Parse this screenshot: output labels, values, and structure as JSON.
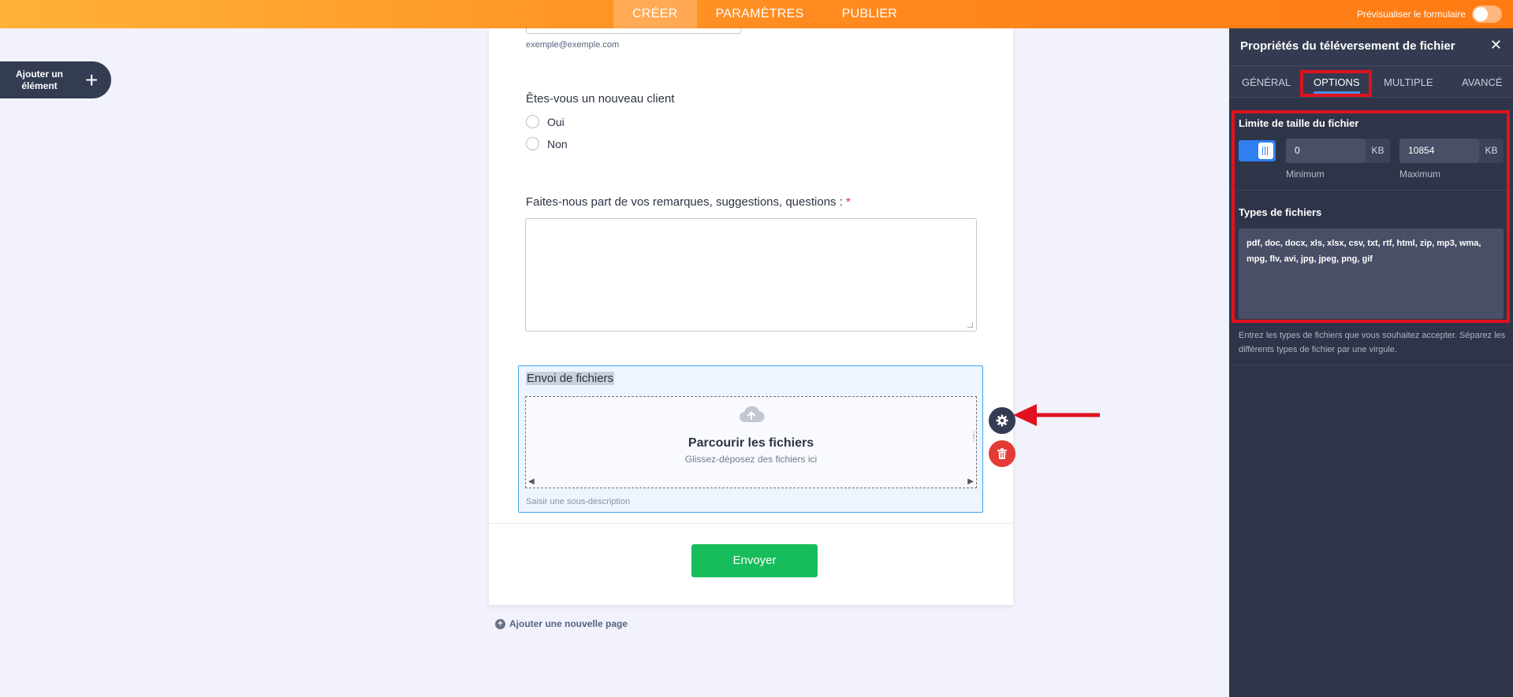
{
  "topbar": {
    "tabs": [
      "CRÉER",
      "PARAMÈTRES",
      "PUBLIER"
    ],
    "preview_label": "Prévisualiser le formulaire"
  },
  "sidebar": {
    "add_element_label": "Ajouter un élément"
  },
  "form": {
    "email_hint": "exemple@exemple.com",
    "question_new_client": "Êtes-vous un nouveau client",
    "radio_options": [
      "Oui",
      "Non"
    ],
    "question_feedback": "Faites-nous part de vos remarques, suggestions, questions :",
    "required_mark": "*",
    "upload_title": "Envoi de fichiers",
    "upload_browse": "Parcourir les fichiers",
    "upload_drag": "Glissez-déposez des fichiers ici",
    "upload_subdesc_placeholder": "Saisir une sous-description",
    "submit_label": "Envoyer",
    "add_page_label": "Ajouter une nouvelle page"
  },
  "panel": {
    "title": "Propriétés du téléversement de fichier",
    "close_glyph": "✕",
    "tabs": [
      "GÉNÉRAL",
      "OPTIONS",
      "MULTIPLE",
      "AVANCÉ"
    ],
    "active_tab": "OPTIONS",
    "size_limit_label": "Limite de taille du fichier",
    "size_limit_enabled": true,
    "min_value": "0",
    "max_value": "10854",
    "unit": "KB",
    "min_label": "Minimum",
    "max_label": "Maximum",
    "file_types_label": "Types de fichiers",
    "file_types_value": "pdf, doc, docx, xls, xlsx, csv, txt, rtf, html, zip, mp3, wma, mpg, flv, avi, jpg, jpeg, png, gif",
    "help_text": "Entrez les types de fichiers que vous souhaitez accepter. Séparez les différents types de fichier par une virgule."
  },
  "colors": {
    "topbar_start": "#ffb13a",
    "topbar_end": "#ff7a12",
    "panel_bg": "#2f3549",
    "submit_green": "#18bd5b",
    "highlight_red": "#e0121f",
    "toggle_blue": "#2f7ff0"
  },
  "icons": [
    "plus-icon",
    "cloud-upload-icon",
    "gear-icon",
    "trash-icon",
    "close-icon",
    "add-page-icon",
    "arrow-pointer-icon"
  ]
}
